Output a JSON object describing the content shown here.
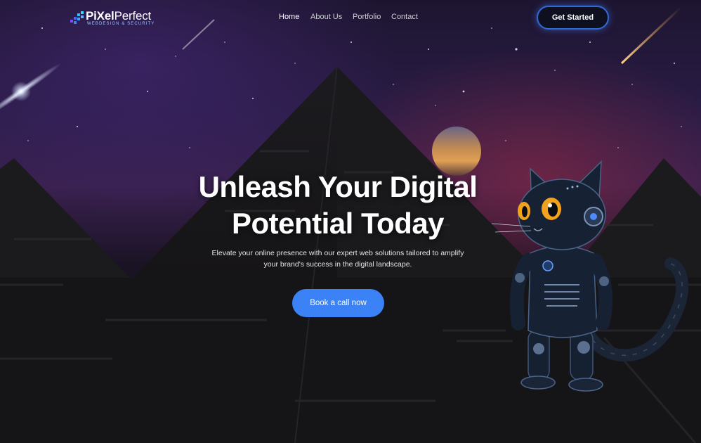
{
  "header": {
    "logo": {
      "name_part1": "PiXel",
      "name_part2": "Perfect",
      "tagline": "WEBDESIGN & SECURITY"
    },
    "nav": [
      {
        "label": "Home",
        "active": true
      },
      {
        "label": "About Us",
        "active": false
      },
      {
        "label": "Portfolio",
        "active": false
      },
      {
        "label": "Contact",
        "active": false
      }
    ],
    "cta_label": "Get Started"
  },
  "hero": {
    "title_line1": "Unleash Your Digital",
    "title_line2": "Potential Today",
    "subtitle_line1": "Elevate your online presence with our expert web solutions tailored to amplify",
    "subtitle_line2": "your brand's success in the digital landscape.",
    "cta_label": "Book a call now"
  },
  "colors": {
    "accent": "#3b82f6",
    "header_button_border": "#2f6bd8",
    "background": "#121115"
  },
  "illustration": {
    "mascot": "robot-cat",
    "scenery": "pyramids-under-starry-sky"
  }
}
